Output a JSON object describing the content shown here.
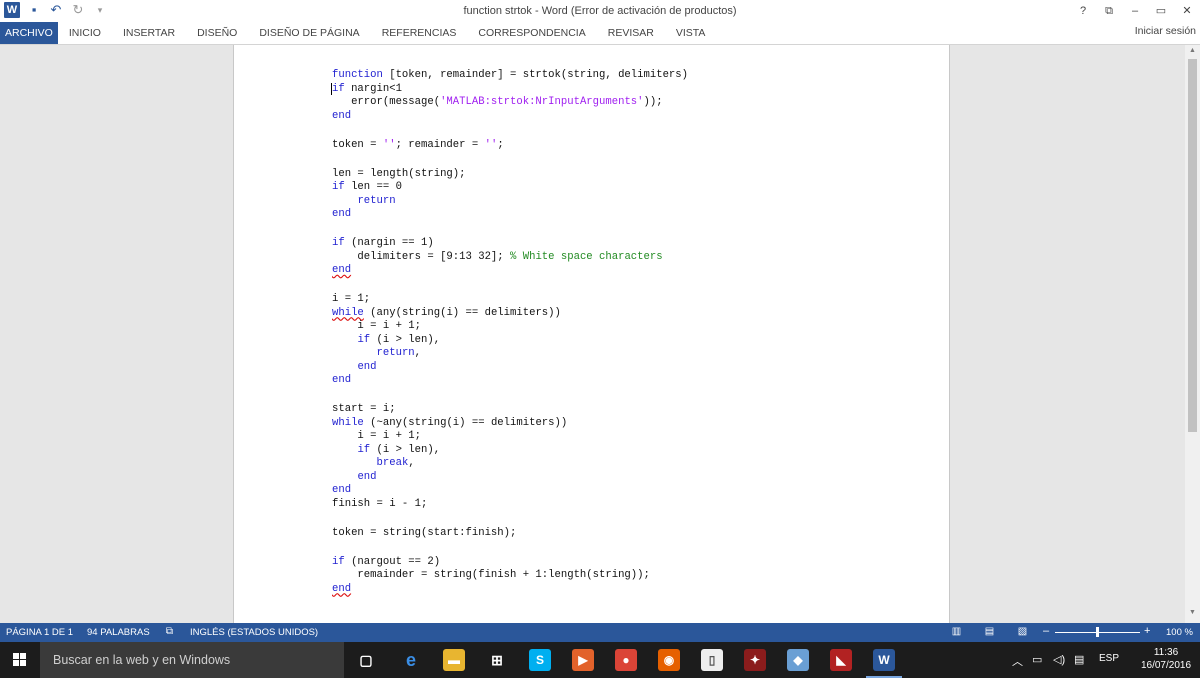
{
  "window": {
    "title": "function strtok - Word (Error de activación de productos)",
    "controls": [
      "?",
      "⧉",
      "–",
      "▭",
      "✕"
    ]
  },
  "quick_access": {
    "logo": "W",
    "icons": [
      "save-icon",
      "undo-icon",
      "redo-icon",
      "customize-icon"
    ]
  },
  "ribbon": {
    "tabs": [
      "ARCHIVO",
      "INICIO",
      "INSERTAR",
      "DISEÑO",
      "DISEÑO DE PÁGINA",
      "REFERENCIAS",
      "CORRESPONDENCIA",
      "REVISAR",
      "VISTA"
    ],
    "active_tab": "ARCHIVO",
    "signin": "Iniciar sesión"
  },
  "document": {
    "lines": [
      [
        {
          "t": "function",
          "c": "kw"
        },
        {
          "t": " [token, remainder] = strtok(string, delimiters)"
        }
      ],
      [
        {
          "t": "i",
          "c": "kw caret"
        },
        {
          "t": "f",
          "c": "kw"
        },
        {
          "t": " nargin<1"
        }
      ],
      [
        {
          "t": "   error(message("
        },
        {
          "t": "'MATLAB:strtok:NrInputArguments'",
          "c": "str"
        },
        {
          "t": "));"
        }
      ],
      [
        {
          "t": "end",
          "c": "kw"
        }
      ],
      [],
      [
        {
          "t": "token = "
        },
        {
          "t": "''",
          "c": "str"
        },
        {
          "t": "; remainder = "
        },
        {
          "t": "''",
          "c": "str"
        },
        {
          "t": ";"
        }
      ],
      [],
      [
        {
          "t": "len = length(string);"
        }
      ],
      [
        {
          "t": "if",
          "c": "kw"
        },
        {
          "t": " len == 0"
        }
      ],
      [
        {
          "t": "    "
        },
        {
          "t": "return",
          "c": "kw"
        }
      ],
      [
        {
          "t": "end",
          "c": "kw"
        }
      ],
      [],
      [
        {
          "t": "if",
          "c": "kw"
        },
        {
          "t": " (nargin == 1)"
        }
      ],
      [
        {
          "t": "    delimiters = [9:13 32]; "
        },
        {
          "t": "% White space characters",
          "c": "cm"
        }
      ],
      [
        {
          "t": "end",
          "c": "kw squig"
        }
      ],
      [],
      [
        {
          "t": "i = 1;"
        }
      ],
      [
        {
          "t": "while",
          "c": "kw squig"
        },
        {
          "t": " (any(string(i) == delimiters))"
        }
      ],
      [
        {
          "t": "    i = i + 1;"
        }
      ],
      [
        {
          "t": "    "
        },
        {
          "t": "if",
          "c": "kw"
        },
        {
          "t": " (i > len),"
        }
      ],
      [
        {
          "t": "       "
        },
        {
          "t": "return",
          "c": "kw"
        },
        {
          "t": ","
        }
      ],
      [
        {
          "t": "    "
        },
        {
          "t": "end",
          "c": "kw"
        }
      ],
      [
        {
          "t": "end",
          "c": "kw"
        }
      ],
      [],
      [
        {
          "t": "start = i;"
        }
      ],
      [
        {
          "t": "while",
          "c": "kw"
        },
        {
          "t": " (~any(string(i) == delimiters))"
        }
      ],
      [
        {
          "t": "    i = i + 1;"
        }
      ],
      [
        {
          "t": "    "
        },
        {
          "t": "if",
          "c": "kw"
        },
        {
          "t": " (i > len),"
        }
      ],
      [
        {
          "t": "       "
        },
        {
          "t": "break",
          "c": "kw"
        },
        {
          "t": ","
        }
      ],
      [
        {
          "t": "    "
        },
        {
          "t": "end",
          "c": "kw"
        }
      ],
      [
        {
          "t": "end",
          "c": "kw"
        }
      ],
      [
        {
          "t": "finish = i - 1;"
        }
      ],
      [],
      [
        {
          "t": "token = string(start:finish);"
        }
      ],
      [],
      [
        {
          "t": "if",
          "c": "kw"
        },
        {
          "t": " (nargout == 2)"
        }
      ],
      [
        {
          "t": "    remainder = string(finish + 1:length(string));"
        }
      ],
      [
        {
          "t": "end",
          "c": "kw squig"
        }
      ]
    ]
  },
  "statusbar": {
    "page": "PÁGINA 1 DE 1",
    "words": "94 PALABRAS",
    "language": "INGLÉS (ESTADOS UNIDOS)",
    "zoom_minus": "–",
    "zoom_plus": "+",
    "zoom": "100 %",
    "zoom_value_percent": 100
  },
  "taskbar": {
    "search_placeholder": "Buscar en la web y en Windows",
    "apps": [
      {
        "name": "task-view",
        "label": "▢",
        "color": "#1c1c1c"
      },
      {
        "name": "edge",
        "label": "e",
        "color": "#1c1c1c"
      },
      {
        "name": "file-explorer",
        "label": "▬",
        "color": "#e8b530"
      },
      {
        "name": "store",
        "label": "⊞",
        "color": "#1c1c1c"
      },
      {
        "name": "skype",
        "label": "S",
        "color": "#00aff0"
      },
      {
        "name": "media-player",
        "label": "▶",
        "color": "#e2622b"
      },
      {
        "name": "chrome",
        "label": "●",
        "color": "#db4437"
      },
      {
        "name": "firefox",
        "label": "◉",
        "color": "#e66000"
      },
      {
        "name": "notepad",
        "label": "▯",
        "color": "#eeeeee"
      },
      {
        "name": "game-app",
        "label": "✦",
        "color": "#8b1c1c"
      },
      {
        "name": "paint-app",
        "label": "◆",
        "color": "#6a9fd4"
      },
      {
        "name": "dota",
        "label": "◣",
        "color": "#b22222"
      },
      {
        "name": "word",
        "label": "W",
        "color": "#2b579a"
      }
    ],
    "active_app": "word",
    "tray_language": "ESP",
    "time": "11:36",
    "date": "16/07/2016"
  }
}
